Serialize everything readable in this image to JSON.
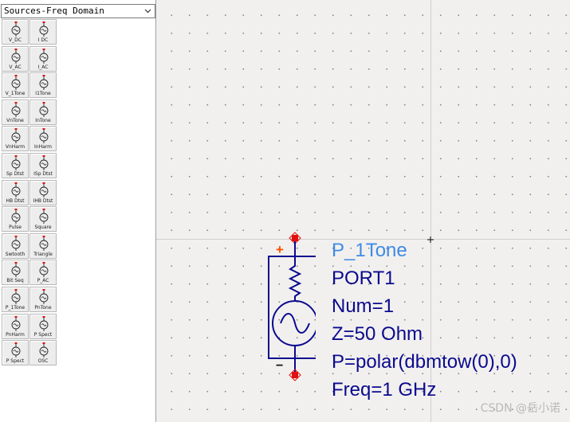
{
  "palette": {
    "library": "Sources-Freq Domain",
    "items": [
      {
        "label": "V_DC",
        "icon": "dc-voltage-source-icon"
      },
      {
        "label": "I DC",
        "icon": "dc-current-source-icon"
      },
      {
        "label": "V_AC",
        "icon": "ac-voltage-source-icon"
      },
      {
        "label": "I_AC",
        "icon": "ac-current-source-icon"
      },
      {
        "label": "V_1Tone",
        "icon": "one-tone-voltage-icon"
      },
      {
        "label": "I1Tone",
        "icon": "one-tone-current-icon"
      },
      {
        "label": "VnTone",
        "icon": "n-tone-voltage-icon"
      },
      {
        "label": "InTone",
        "icon": "n-tone-current-icon"
      },
      {
        "label": "VnHarm",
        "icon": "n-harm-voltage-icon"
      },
      {
        "label": "InHarm",
        "icon": "n-harm-current-icon"
      },
      {
        "label": "Sp Dtst",
        "icon": "sp-dataset-voltage-icon"
      },
      {
        "label": "ISp Dtst",
        "icon": "sp-dataset-current-icon"
      },
      {
        "label": "HB Dtst",
        "icon": "hb-dataset-voltage-icon"
      },
      {
        "label": "IHB Dtst",
        "icon": "hb-dataset-current-icon"
      },
      {
        "label": "Pulse",
        "icon": "pulse-source-icon"
      },
      {
        "label": "Square",
        "icon": "square-source-icon"
      },
      {
        "label": "Swtooth",
        "icon": "sawtooth-source-icon"
      },
      {
        "label": "Triangle",
        "icon": "triangle-source-icon"
      },
      {
        "label": "Bit Seq",
        "icon": "bit-sequence-icon"
      },
      {
        "label": "P_AC",
        "icon": "p-ac-port-icon"
      },
      {
        "label": "P_1Tone",
        "icon": "p-1tone-port-icon"
      },
      {
        "label": "PnTone",
        "icon": "p-ntone-port-icon"
      },
      {
        "label": "PnHarm",
        "icon": "p-nharm-port-icon"
      },
      {
        "label": "P Spect",
        "icon": "p-spect-port-icon"
      },
      {
        "label": "P Spect",
        "icon": "f-p-spect-port-icon"
      },
      {
        "label": "OSC",
        "icon": "oscillator-icon"
      }
    ]
  },
  "component": {
    "name": "P_1Tone",
    "instance": "PORT1",
    "params": [
      "Num=1",
      "Z=50 Ohm",
      "P=polar(dbmtow(0),0)",
      "Freq=1 GHz"
    ],
    "plus": "+",
    "minus": "−"
  },
  "watermark": "CSDN @岳小诺",
  "colors": {
    "wire": "#0a0a8f",
    "pin": "#e01010",
    "plus": "#ff5500",
    "name": "#3f8be6"
  }
}
